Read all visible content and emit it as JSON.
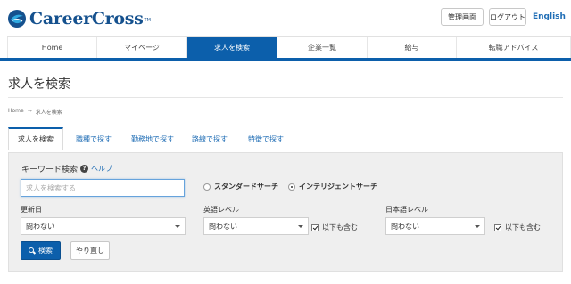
{
  "header": {
    "logo_text": "CareerCross",
    "logo_tm": "TM",
    "admin_label": "管理画面",
    "logout_label": "ログアウト",
    "english_label": "English"
  },
  "nav": {
    "items": [
      {
        "label": "Home"
      },
      {
        "label": "マイページ"
      },
      {
        "label": "求人を検索"
      },
      {
        "label": "企業一覧"
      },
      {
        "label": "給与"
      },
      {
        "label": "転職アドバイス"
      }
    ],
    "active_index": 2
  },
  "page": {
    "title": "求人を検索"
  },
  "breadcrumb": {
    "home": "Home",
    "separator": "→",
    "current": "求人を検索"
  },
  "tabs": [
    {
      "label": "求人を検索"
    },
    {
      "label": "職種で探す"
    },
    {
      "label": "勤務地で探す"
    },
    {
      "label": "路線で探す"
    },
    {
      "label": "特徴で探す"
    }
  ],
  "search": {
    "keyword_label": "キーワード検索",
    "help_label": "ヘルプ",
    "keyword_value": "",
    "keyword_placeholder": "求人を検索する",
    "mode_standard": "スタンダードサーチ",
    "mode_intelligent": "インテリジェントサーチ",
    "selected_mode": "intelligent",
    "updated_label": "更新日",
    "updated_value": "問わない",
    "english_label": "英語レベル",
    "english_value": "問わない",
    "english_include_lower": "以下も含む",
    "japanese_label": "日本語レベル",
    "japanese_value": "問わない",
    "japanese_include_lower": "以下も含む",
    "search_button": "検索",
    "reset_button": "やり直し"
  },
  "colors": {
    "brand": "#0c5fab",
    "link": "#1f6db5",
    "panel_bg": "#efefef"
  }
}
